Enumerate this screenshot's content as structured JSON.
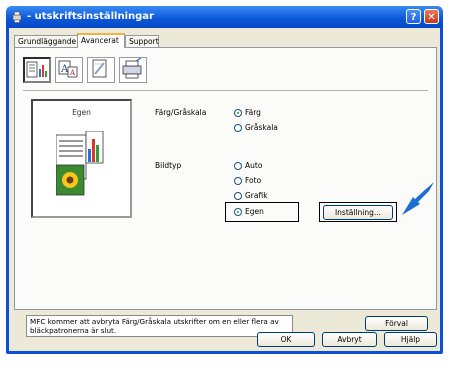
{
  "window": {
    "title": "utskriftsinställningar"
  },
  "tabs": [
    "Grundläggande",
    "Avancerat",
    "Support"
  ],
  "active_tab": "Avancerat",
  "toolbar": {
    "icons": [
      "color-settings-icon",
      "scaling-icon",
      "watermark-icon",
      "device-options-icon"
    ]
  },
  "preview": {
    "label": "Egen"
  },
  "color_mode": {
    "label": "Färg/Gråskala",
    "options": [
      "Färg",
      "Gråskala"
    ],
    "selected": "Färg"
  },
  "image_type": {
    "label": "Bildtyp",
    "options": [
      "Auto",
      "Foto",
      "Grafik",
      "Egen"
    ],
    "selected": "Egen"
  },
  "settings_button": "Inställning...",
  "message": "MFC kommer att avbryta Färg/Gråskala utskrifter om en eller flera av bläckpatronerna är slut.",
  "buttons": {
    "default": "Förval",
    "ok": "OK",
    "cancel": "Avbryt",
    "help": "Hjälp"
  },
  "colors": {
    "titlebar": "#0a56d8",
    "arrow": "#1f6fd0",
    "dialog_bg": "#ece9d8"
  }
}
